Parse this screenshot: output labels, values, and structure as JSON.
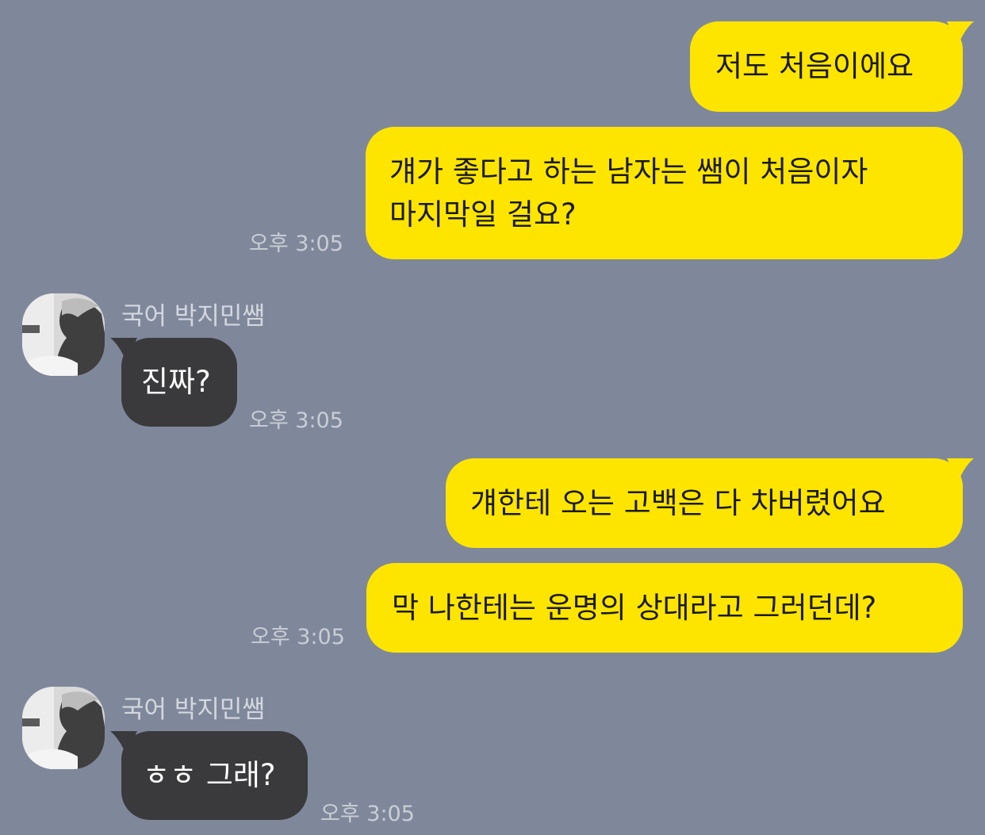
{
  "colors": {
    "background": "#7f889b",
    "sent_bubble": "#fee500",
    "received_bubble": "#3a3a3c",
    "timestamp": "#c9cdd5"
  },
  "messages": [
    {
      "direction": "sent",
      "lines": [
        "저도 처음이에요"
      ]
    },
    {
      "direction": "sent",
      "lines": [
        "걔가 좋다고 하는 남자는 쌤이 처음이자",
        "마지막일 걸요?"
      ],
      "time": "오후 3:05"
    },
    {
      "direction": "received",
      "sender": "국어 박지민쌤",
      "avatar": "profile-photo",
      "lines": [
        "진짜?"
      ],
      "time": "오후 3:05"
    },
    {
      "direction": "sent",
      "lines": [
        "걔한테 오는 고백은 다 차버렸어요"
      ]
    },
    {
      "direction": "sent",
      "lines": [
        "막 나한테는 운명의 상대라고 그러던데?"
      ],
      "time": "오후 3:05"
    },
    {
      "direction": "received",
      "sender": "국어 박지민쌤",
      "avatar": "profile-photo",
      "lines": [
        "ㅎㅎ 그래?"
      ],
      "time": "오후 3:05"
    }
  ]
}
